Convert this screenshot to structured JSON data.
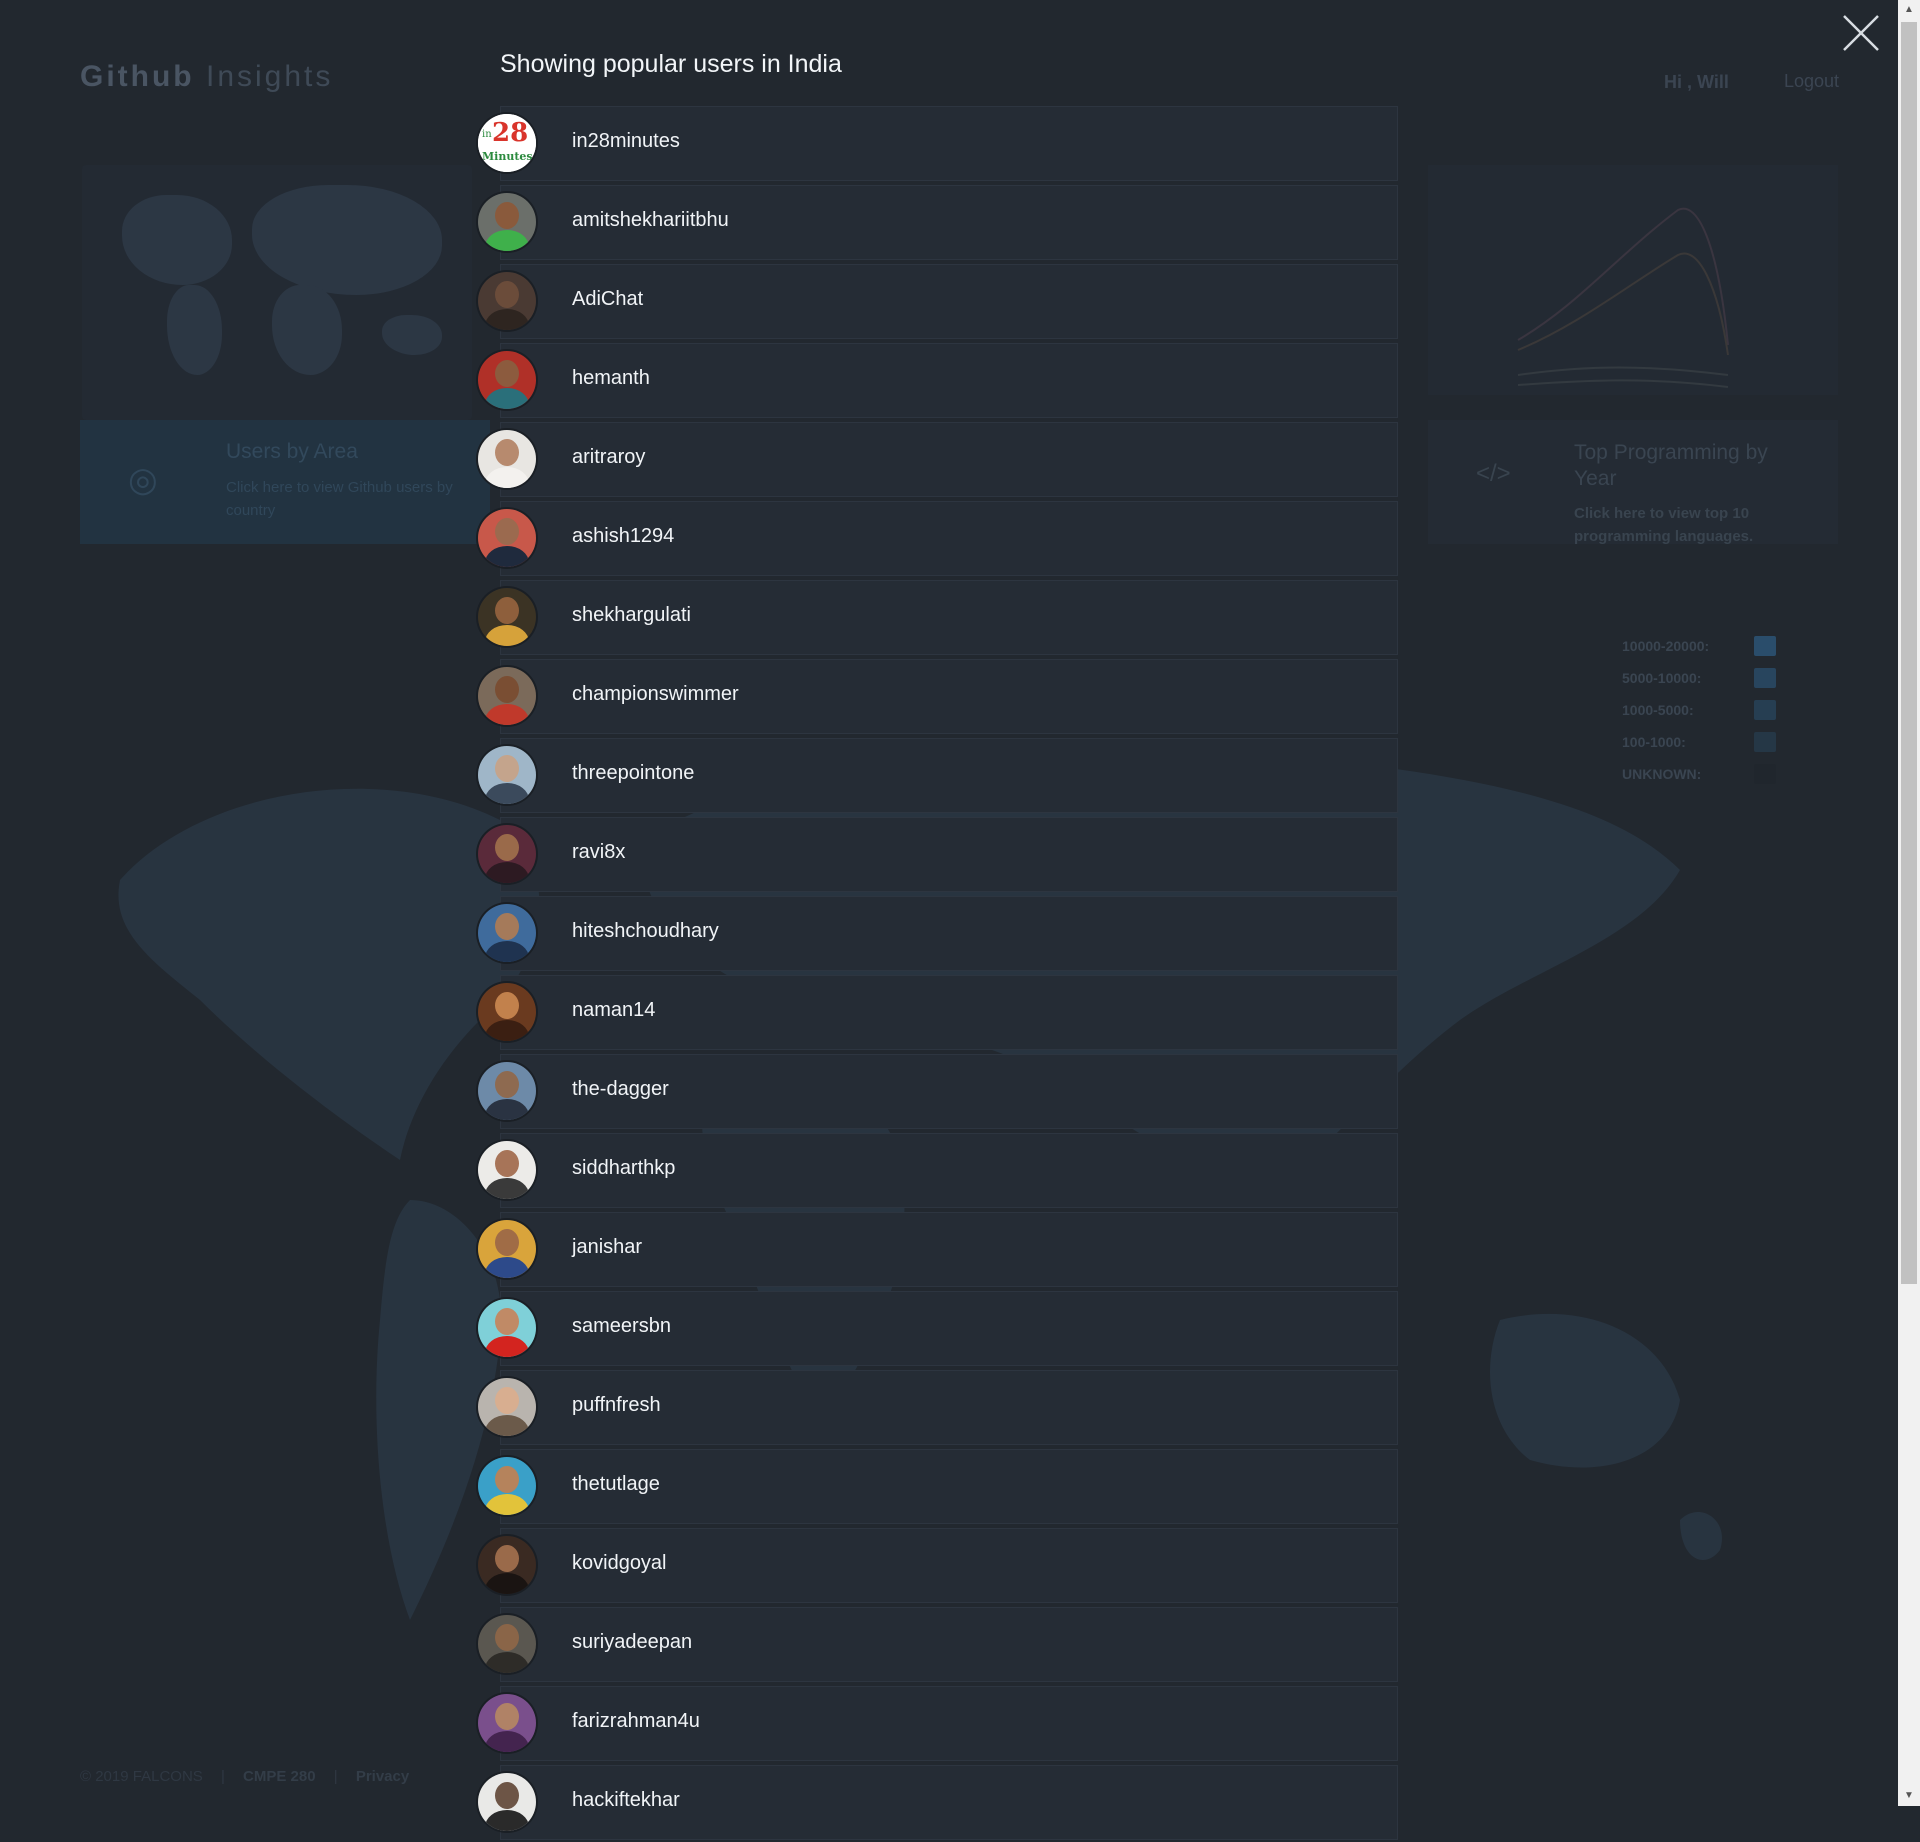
{
  "header": {
    "brand_bold": "Github",
    "brand_light": "Insights",
    "greeting": "Hi , Will",
    "logout_label": "Logout"
  },
  "cards": {
    "area": {
      "title": "Users by Area",
      "subtitle": "Click here to view Github users by country"
    },
    "programming": {
      "title": "Top Programming by Year",
      "subtitle": "Click here to view top 10 programming languages."
    }
  },
  "legend": [
    {
      "label": "10000-20000:",
      "color": "#2a4d6b"
    },
    {
      "label": "5000-10000:",
      "color": "#28455e"
    },
    {
      "label": "1000-5000:",
      "color": "#263e52"
    },
    {
      "label": "100-1000:",
      "color": "#253746"
    },
    {
      "label": "UNKNOWN:",
      "color": "#20262d"
    }
  ],
  "footer": {
    "copyright": "© 2019 FALCONS",
    "course": "CMPE 280",
    "privacy": "Privacy"
  },
  "modal": {
    "title": "Showing popular users in India",
    "users": [
      {
        "name": "in28minutes",
        "avatar": "logo-28minutes",
        "bg": "#ffffff",
        "skin": "#000",
        "shirt": "#000"
      },
      {
        "name": "amitshekhariitbhu",
        "avatar": "user-photo",
        "bg": "#6b6f6a",
        "skin": "#8a5a3c",
        "shirt": "#3fb04b"
      },
      {
        "name": "AdiChat",
        "avatar": "user-photo",
        "bg": "#4a3a33",
        "skin": "#6b4c3a",
        "shirt": "#2e2520"
      },
      {
        "name": "hemanth",
        "avatar": "user-photo",
        "bg": "#b03028",
        "skin": "#8c5b3e",
        "shirt": "#2a6f7a"
      },
      {
        "name": "aritraroy",
        "avatar": "user-photo",
        "bg": "#e8e6e2",
        "skin": "#b78a6e",
        "shirt": "#f3f1ee"
      },
      {
        "name": "ashish1294",
        "avatar": "user-photo",
        "bg": "#c8584a",
        "skin": "#9b6a4f",
        "shirt": "#1f2a3d"
      },
      {
        "name": "shekhargulati",
        "avatar": "user-photo",
        "bg": "#3b3324",
        "skin": "#8e5f3c",
        "shirt": "#d6a23a"
      },
      {
        "name": "championswimmer",
        "avatar": "user-photo",
        "bg": "#7b6a5a",
        "skin": "#7a4e33",
        "shirt": "#c0392b"
      },
      {
        "name": "threepointone",
        "avatar": "user-photo",
        "bg": "#9fb6c8",
        "skin": "#c4a48c",
        "shirt": "#3b4a5c"
      },
      {
        "name": "ravi8x",
        "avatar": "user-photo",
        "bg": "#5a2a3a",
        "skin": "#9a6a4a",
        "shirt": "#2d1a22"
      },
      {
        "name": "hiteshchoudhary",
        "avatar": "user-photo",
        "bg": "#3f6b9c",
        "skin": "#a57a5a",
        "shirt": "#1f3350"
      },
      {
        "name": "naman14",
        "avatar": "user-photo",
        "bg": "#6a3a1f",
        "skin": "#c2814c",
        "shirt": "#3b1f12"
      },
      {
        "name": "the-dagger",
        "avatar": "user-photo",
        "bg": "#6d8aa8",
        "skin": "#8e6a50",
        "shirt": "#2a3342"
      },
      {
        "name": "siddharthkp",
        "avatar": "user-photo",
        "bg": "#ecebe8",
        "skin": "#a77458",
        "shirt": "#3a3a3a"
      },
      {
        "name": "janishar",
        "avatar": "user-photo",
        "bg": "#d9a43b",
        "skin": "#a06c46",
        "shirt": "#2d4a8a"
      },
      {
        "name": "sameersbn",
        "avatar": "user-photo",
        "bg": "#7fd0d8",
        "skin": "#c08a66",
        "shirt": "#d3241f"
      },
      {
        "name": "puffnfresh",
        "avatar": "user-photo",
        "bg": "#b9b4ae",
        "skin": "#d8ae90",
        "shirt": "#6b5a4a"
      },
      {
        "name": "thetutlage",
        "avatar": "user-photo",
        "bg": "#3aa0c8",
        "skin": "#b5835c",
        "shirt": "#e2c33a"
      },
      {
        "name": "kovidgoyal",
        "avatar": "user-photo",
        "bg": "#3a2a22",
        "skin": "#9a6a4a",
        "shirt": "#1a1412"
      },
      {
        "name": "suriyadeepan",
        "avatar": "user-photo",
        "bg": "#5a5750",
        "skin": "#8a6548",
        "shirt": "#2e2c28"
      },
      {
        "name": "farizrahman4u",
        "avatar": "user-photo",
        "bg": "#7a4f8c",
        "skin": "#b08266",
        "shirt": "#44244f"
      },
      {
        "name": "hackiftekhar",
        "avatar": "user-photo",
        "bg": "#e9e9e7",
        "skin": "#6d5546",
        "shirt": "#2a2a2a"
      }
    ]
  }
}
